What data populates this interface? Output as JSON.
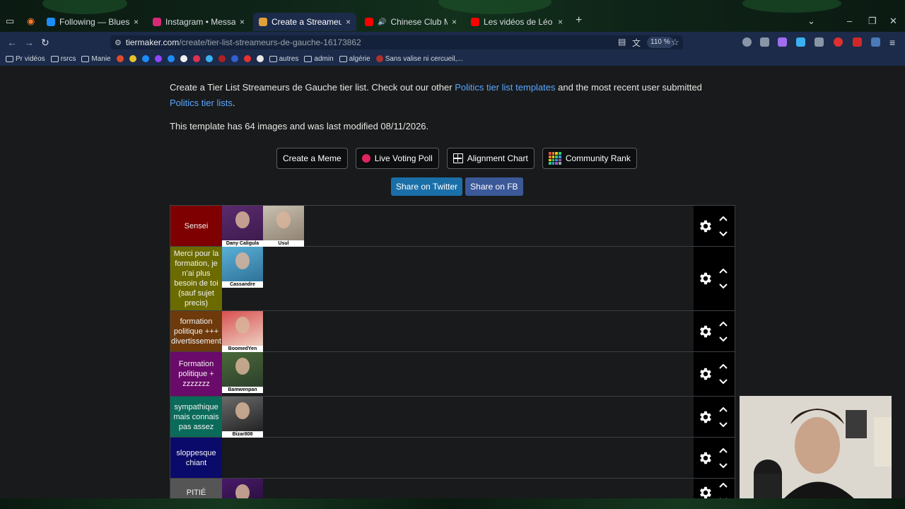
{
  "browser": {
    "tabs": [
      {
        "title": "Following — Bluesky",
        "color": "#1d8cf8"
      },
      {
        "title": "Instagram • Messages",
        "color": "#d62976"
      },
      {
        "title": "Create a Streameurs de Gauche",
        "color": "#e0a03a",
        "active": true
      },
      {
        "title": "Chinese Club Mix at a Senic",
        "color": "#ff0000"
      },
      {
        "title": "Les vidéos de Léo - YouTube",
        "color": "#ff0000"
      }
    ],
    "url_host": "tiermaker.com",
    "url_path": "/create/tier-list-streameurs-de-gauche-16173862",
    "zoom": "110 %",
    "bookmarks": [
      "Pr vidéos",
      "rsrcs",
      "Manie",
      "autres",
      "admin",
      "algérie",
      "Sans valise ni cercueil,..."
    ]
  },
  "page": {
    "intro_part1": "Create a Tier List Streameurs de Gauche tier list. Check out our other ",
    "intro_link1": "Politics tier list templates",
    "intro_part2": " and the most recent user submitted ",
    "intro_link2": "Politics tier lists",
    "intro_part3": ".",
    "info": "This template has 64 images and was last modified 08/11/2026.",
    "buttons": {
      "meme": "Create a Meme",
      "poll": "Live Voting Poll",
      "alignment": "Alignment Chart",
      "community": "Community Rank"
    },
    "share": {
      "twitter": "Share on Twitter",
      "facebook": "Share on FB"
    }
  },
  "tiers": [
    {
      "label": "Sensei",
      "color": "#7f0000",
      "items": [
        "Dany Caligula",
        "Usul"
      ]
    },
    {
      "label": "Merci pour la formation, je n'ai plus besoin de toi (sauf sujet precis)",
      "color": "#6b6b00",
      "items": [
        "Cassandre"
      ]
    },
    {
      "label": "formation politique +++ divertissement",
      "color": "#6e3a0c",
      "items": [
        "BoomedYen"
      ]
    },
    {
      "label": "Formation politique + zzzzzzz",
      "color": "#6a0a6a",
      "items": [
        "Bamwenpan"
      ]
    },
    {
      "label": "sympathique mais connais pas assez",
      "color": "#0a6b5a",
      "items": [
        "Bizar808"
      ]
    },
    {
      "label": "sloppesque chiant",
      "color": "#0a0a6b",
      "items": []
    },
    {
      "label": "PITIÉ",
      "color": "#555555",
      "items": [
        ""
      ]
    }
  ]
}
